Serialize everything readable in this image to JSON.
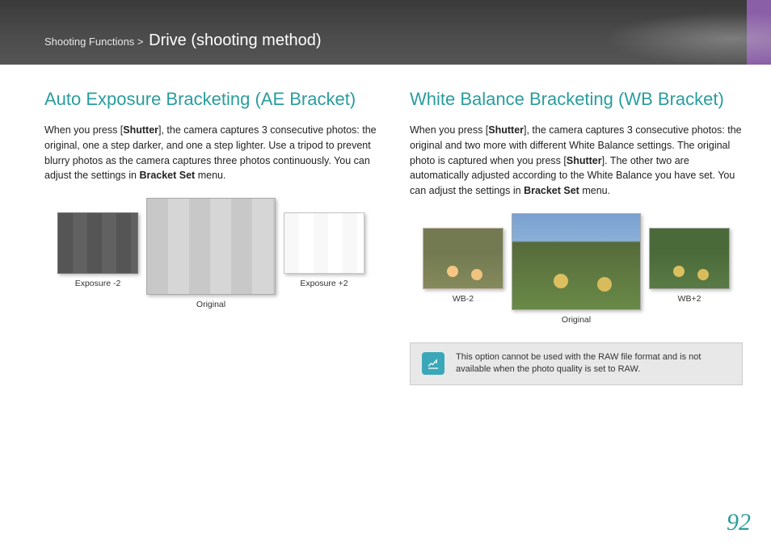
{
  "header": {
    "breadcrumb_section": "Shooting Functions",
    "separator": " > ",
    "title": "Drive (shooting method)"
  },
  "ae": {
    "heading": "Auto Exposure Bracketing (AE Bracket)",
    "p1": "When you press [",
    "p2": "Shutter",
    "p3": "], the camera captures 3 consecutive photos: the original, one a step darker, and one a step lighter. Use a tripod to prevent blurry photos as the camera captures three photos continuously. You can adjust the settings in ",
    "p4": "Bracket Set",
    "p5": " menu.",
    "caption_left": "Exposure -2",
    "caption_center": "Original",
    "caption_right": "Exposure +2"
  },
  "wb": {
    "heading": "White Balance Bracketing (WB Bracket)",
    "p1": "When you press [",
    "p2": "Shutter",
    "p3": "], the camera captures 3 consecutive photos: the original and two more with different White Balance settings. The original photo is captured when you press [",
    "p4": "Shutter",
    "p5": "]. The other two are automatically adjusted according to the White Balance you have set. You can adjust the settings in ",
    "p6": "Bracket Set",
    "p7": " menu.",
    "caption_left": "WB-2",
    "caption_center": "Original",
    "caption_right": "WB+2",
    "note": "This option cannot be used with the RAW file format and is not available when the photo quality is set to RAW."
  },
  "page_number": "92"
}
